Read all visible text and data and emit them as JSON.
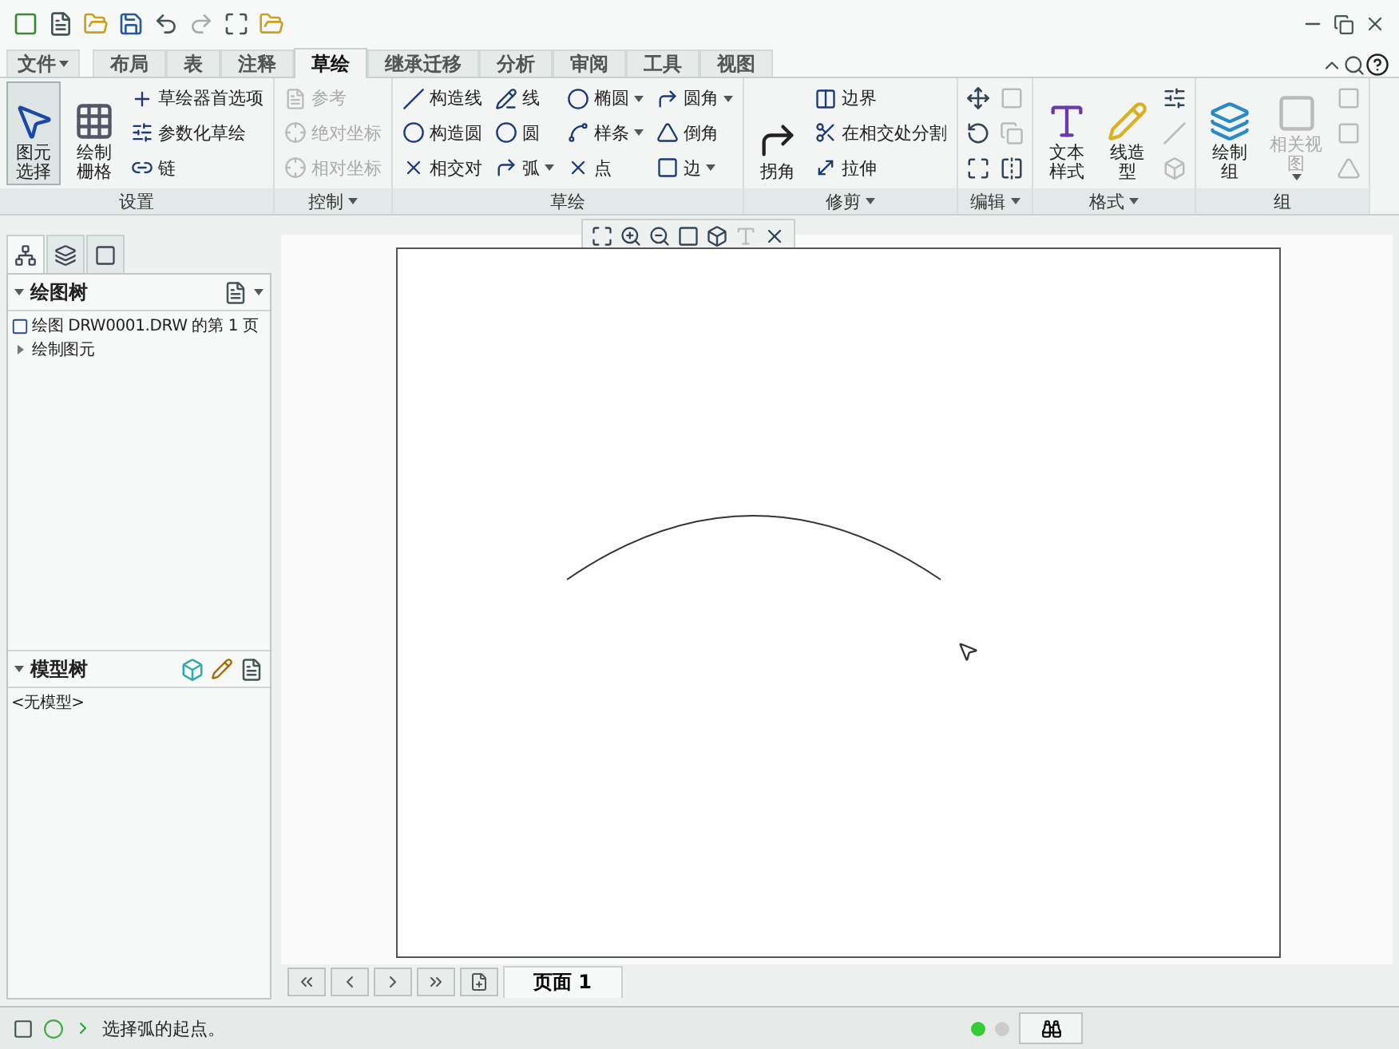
{
  "menu_tabs": [
    {
      "label": "文件",
      "kind": "menu",
      "selected": false
    },
    {
      "label": "布局",
      "kind": "tab",
      "selected": false
    },
    {
      "label": "表",
      "kind": "tab",
      "selected": false
    },
    {
      "label": "注释",
      "kind": "tab",
      "selected": false
    },
    {
      "label": "草绘",
      "kind": "tab",
      "selected": true
    },
    {
      "label": "继承迁移",
      "kind": "tab",
      "selected": false
    },
    {
      "label": "分析",
      "kind": "tab",
      "selected": false
    },
    {
      "label": "审阅",
      "kind": "tab",
      "selected": false
    },
    {
      "label": "工具",
      "kind": "tab",
      "selected": false
    },
    {
      "label": "视图",
      "kind": "tab",
      "selected": false
    }
  ],
  "ribbon_groups": [
    {
      "label": "设置",
      "dropdown": false,
      "columns": [
        {
          "kind": "large",
          "lines": [
            "图元",
            "选择"
          ],
          "selected": true,
          "disabled": false,
          "dropdown": false
        },
        {
          "kind": "large",
          "lines": [
            "绘制",
            "栅格"
          ],
          "selected": false,
          "disabled": false,
          "dropdown": false
        },
        {
          "kind": "stack",
          "items": [
            {
              "label": "草绘器首选项",
              "disabled": false,
              "dropdown": false
            },
            {
              "label": "参数化草绘",
              "disabled": false,
              "dropdown": false
            },
            {
              "label": "链",
              "disabled": false,
              "dropdown": false
            }
          ]
        }
      ]
    },
    {
      "label": "控制",
      "dropdown": true,
      "columns": [
        {
          "kind": "stack",
          "items": [
            {
              "label": "参考",
              "disabled": true,
              "dropdown": false
            },
            {
              "label": "绝对坐标",
              "disabled": true,
              "dropdown": false
            },
            {
              "label": "相对坐标",
              "disabled": true,
              "dropdown": false
            }
          ]
        }
      ]
    },
    {
      "label": "草绘",
      "dropdown": false,
      "columns": [
        {
          "kind": "stack",
          "items": [
            {
              "label": "构造线",
              "disabled": false,
              "dropdown": false
            },
            {
              "label": "构造圆",
              "disabled": false,
              "dropdown": false
            },
            {
              "label": "相交对",
              "disabled": false,
              "dropdown": false
            }
          ]
        },
        {
          "kind": "stack",
          "items": [
            {
              "label": "线",
              "disabled": false,
              "dropdown": false
            },
            {
              "label": "圆",
              "disabled": false,
              "dropdown": false
            },
            {
              "label": "弧",
              "disabled": false,
              "dropdown": true
            }
          ]
        },
        {
          "kind": "stack",
          "items": [
            {
              "label": "椭圆",
              "disabled": false,
              "dropdown": true
            },
            {
              "label": "样条",
              "disabled": false,
              "dropdown": true
            },
            {
              "label": "点",
              "disabled": false,
              "dropdown": false
            }
          ]
        },
        {
          "kind": "stack",
          "items": [
            {
              "label": "圆角",
              "disabled": false,
              "dropdown": true
            },
            {
              "label": "倒角",
              "disabled": false,
              "dropdown": false
            },
            {
              "label": "边",
              "disabled": false,
              "dropdown": true
            }
          ]
        }
      ]
    },
    {
      "label": "修剪",
      "dropdown": true,
      "columns": [
        {
          "kind": "large",
          "lines": [
            "拐角"
          ],
          "selected": false,
          "disabled": false,
          "dropdown": false
        },
        {
          "kind": "stack",
          "items": [
            {
              "label": "边界",
              "disabled": false,
              "dropdown": false
            },
            {
              "label": "在相交处分割",
              "disabled": false,
              "dropdown": false
            },
            {
              "label": "拉伸",
              "disabled": false,
              "dropdown": false
            }
          ]
        }
      ]
    },
    {
      "label": "编辑",
      "dropdown": true,
      "columns": [
        {
          "kind": "icons",
          "items": [
            {
              "disabled": false
            },
            {
              "disabled": false
            },
            {
              "disabled": false
            }
          ]
        },
        {
          "kind": "icons",
          "items": [
            {
              "disabled": true
            },
            {
              "disabled": true
            },
            {
              "disabled": false
            }
          ]
        }
      ]
    },
    {
      "label": "格式",
      "dropdown": true,
      "columns": [
        {
          "kind": "large",
          "lines": [
            "文本",
            "样式"
          ],
          "selected": false,
          "disabled": false,
          "dropdown": false
        },
        {
          "kind": "large",
          "lines": [
            "线造",
            "型"
          ],
          "selected": false,
          "disabled": false,
          "dropdown": false
        },
        {
          "kind": "icons",
          "items": [
            {
              "disabled": false
            },
            {
              "disabled": true
            },
            {
              "disabled": true
            }
          ]
        }
      ]
    },
    {
      "label": "组",
      "dropdown": false,
      "columns": [
        {
          "kind": "large",
          "lines": [
            "绘制",
            "组"
          ],
          "selected": false,
          "disabled": false,
          "dropdown": false
        },
        {
          "kind": "large",
          "lines": [
            "相关视",
            "图"
          ],
          "selected": false,
          "disabled": true,
          "dropdown": true
        },
        {
          "kind": "icons",
          "items": [
            {
              "disabled": true
            },
            {
              "disabled": true
            },
            {
              "disabled": true
            }
          ]
        }
      ]
    }
  ],
  "navigator_tabs": [
    {
      "selected": true
    },
    {
      "selected": false
    },
    {
      "selected": false
    }
  ],
  "drawing_tree": {
    "title": "绘图树",
    "items": [
      {
        "label": "绘图 DRW0001.DRW 的第 1 页",
        "kind": "sheet"
      },
      {
        "label": "绘制图元",
        "kind": "folder",
        "expanded": false
      }
    ]
  },
  "model_tree": {
    "title": "模型树",
    "items": [
      {
        "label": "<无模型>"
      }
    ]
  },
  "page_tabs": [
    {
      "label": "页面 1",
      "selected": true
    }
  ],
  "status_bar": {
    "message": "选择弧的起点。"
  }
}
